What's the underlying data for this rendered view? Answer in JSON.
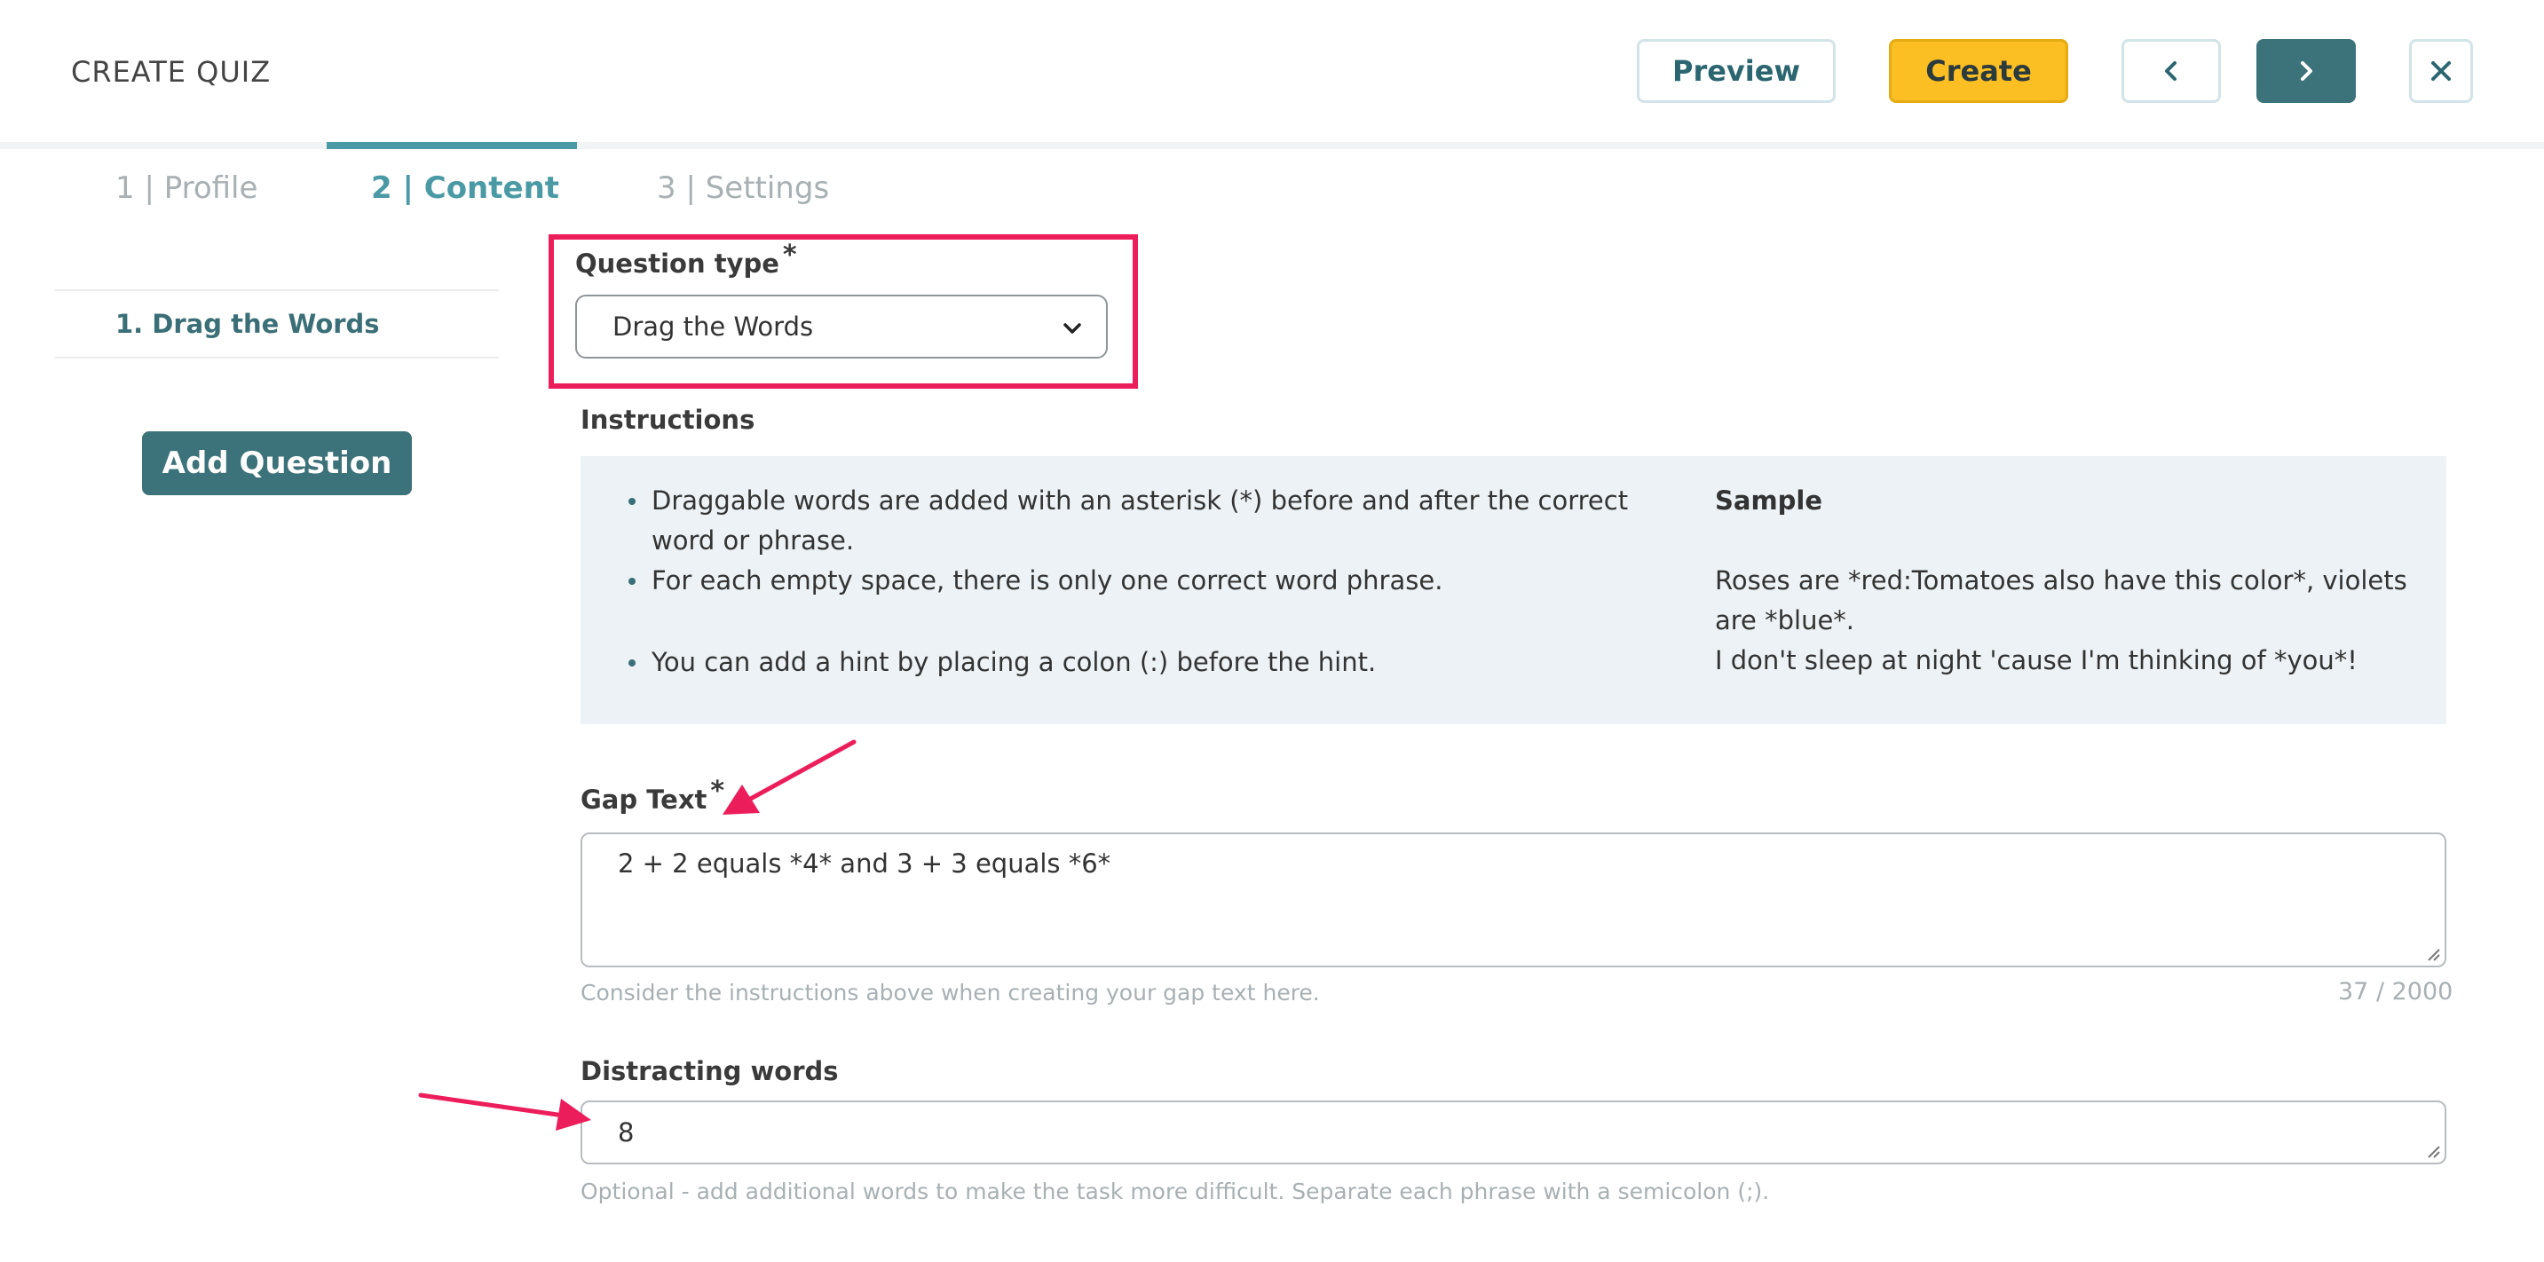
{
  "header": {
    "title": "CREATE QUIZ",
    "preview_label": "Preview",
    "create_label": "Create",
    "prev_icon": "chevron-left-icon",
    "next_icon": "chevron-right-icon",
    "close_icon": "close-icon"
  },
  "tabs": [
    {
      "label": "1 | Profile",
      "active": false
    },
    {
      "label": "2 | Content",
      "active": true
    },
    {
      "label": "3 | Settings",
      "active": false
    }
  ],
  "sidebar": {
    "items": [
      {
        "label": "1. Drag the Words"
      }
    ],
    "add_question_label": "Add Question"
  },
  "question_type": {
    "label": "Question type",
    "required_mark": "*",
    "value": "Drag the Words"
  },
  "instructions": {
    "label": "Instructions",
    "bullets": [
      "Draggable words are added with an asterisk (*) before and after the correct word or phrase.",
      "For each empty space, there is only one correct word phrase.",
      "You can add a hint by placing a colon (:) before the hint."
    ],
    "sample_heading": "Sample",
    "sample_lines": [
      "Roses are *red:Tomatoes also have this color*, violets are *blue*.",
      "I don't sleep at night 'cause I'm thinking of *you*!"
    ]
  },
  "gap_text": {
    "label": "Gap Text",
    "required_mark": "*",
    "value": "2 + 2 equals *4* and 3 + 3 equals *6*",
    "help": "Consider the instructions above when creating your gap text here.",
    "counter": "37 / 2000"
  },
  "distracting_words": {
    "label": "Distracting words",
    "value": "8",
    "help": "Optional - add additional words to make the task more difficult. Separate each phrase with a semicolon (;)."
  },
  "colors": {
    "accent": "#3c7279",
    "tab_active": "#4a9aa5",
    "create_button": "#fbbf24",
    "annotation": "#ec1d5b",
    "instructions_bg": "#ecf2f5"
  }
}
